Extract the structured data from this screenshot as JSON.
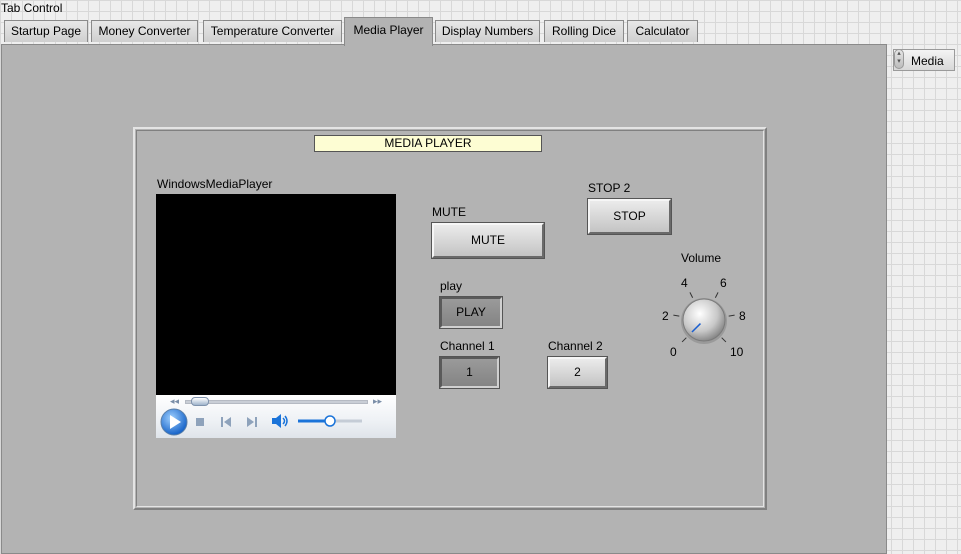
{
  "tab_control": {
    "label": "Tab Control",
    "tabs": [
      {
        "label": "Startup Page"
      },
      {
        "label": "Money Converter"
      },
      {
        "label": "Temperature Converter"
      },
      {
        "label": "Media Player",
        "active": true
      },
      {
        "label": "Display Numbers"
      },
      {
        "label": "Rolling Dice"
      },
      {
        "label": "Calculator"
      }
    ]
  },
  "page_indicator": {
    "value": "Media"
  },
  "media_player": {
    "title": "MEDIA PLAYER",
    "wmp_label": "WindowsMediaPlayer",
    "wmp_controls": {
      "seek_position": 0.03,
      "volume_level": 0.5,
      "icons": [
        "rewind-icon",
        "fast-forward-icon",
        "play-icon",
        "stop-icon",
        "previous-icon",
        "next-icon",
        "speaker-icon"
      ]
    },
    "mute": {
      "label": "MUTE",
      "button": "MUTE"
    },
    "stop": {
      "label": "STOP 2",
      "button": "STOP"
    },
    "play": {
      "label": "play",
      "button": "PLAY"
    },
    "channel1": {
      "label": "Channel 1",
      "button": "1"
    },
    "channel2": {
      "label": "Channel 2",
      "button": "2"
    },
    "volume": {
      "label": "Volume",
      "ticks": [
        "0",
        "2",
        "4",
        "6",
        "8",
        "10"
      ],
      "min": 0,
      "max": 10,
      "value": 0
    }
  },
  "colors": {
    "panel": "#b3b3b3",
    "title_bg": "#fdfdd3",
    "video_bg": "#000000",
    "wmp_blue": "#1a73d9"
  }
}
